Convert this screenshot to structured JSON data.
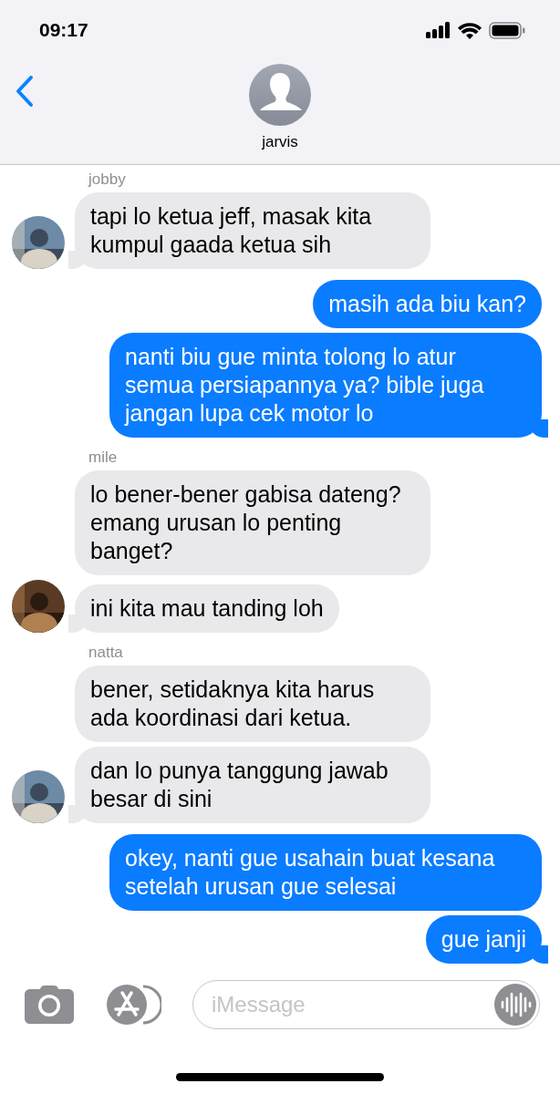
{
  "status_bar": {
    "time": "09:17"
  },
  "contact": {
    "name": "jarvis"
  },
  "groups": [
    {
      "kind": "incoming",
      "sender": "jobby",
      "avatar": {
        "kind": "picture"
      },
      "messages": [
        "tapi lo ketua jeff, masak kita kumpul gaada ketua sih"
      ]
    },
    {
      "kind": "outgoing",
      "messages": [
        "masih ada biu kan?",
        "nanti biu gue minta tolong lo atur semua persiapannya ya? bible juga jangan lupa cek motor lo"
      ]
    },
    {
      "kind": "incoming",
      "sender": "mile",
      "avatar": {
        "kind": "picture"
      },
      "messages": [
        "lo bener-bener gabisa dateng? emang urusan lo penting banget?",
        "ini kita mau tanding loh"
      ]
    },
    {
      "kind": "incoming",
      "sender": "natta",
      "avatar": {
        "kind": "picture"
      },
      "messages": [
        "bener, setidaknya kita harus ada koordinasi dari ketua.",
        "dan lo punya tanggung jawab besar di sini"
      ]
    },
    {
      "kind": "outgoing",
      "messages": [
        "okey, nanti gue usahain buat kesana setelah urusan gue selesai",
        "gue janji"
      ]
    }
  ],
  "composer": {
    "placeholder": "iMessage"
  }
}
